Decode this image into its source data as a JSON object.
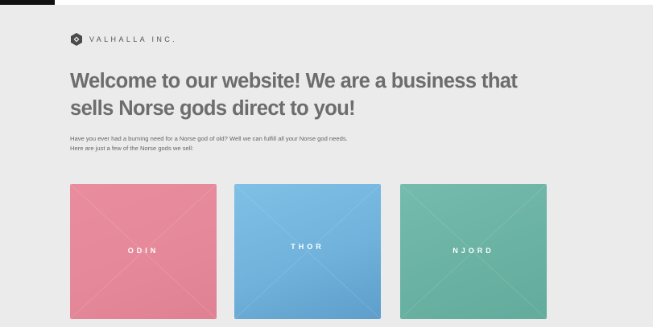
{
  "logo": {
    "text": "VALHALLA INC.",
    "icon": "hexagon-diamond-icon"
  },
  "hero": {
    "title": "Welcome to our website! We are a business that sells Norse gods direct to you!",
    "body_line1": "Have you ever had a burning need for a Norse god of old? Well we can fulfill all your Norse god needs.",
    "body_line2": "Here are just a few of the Norse gods we sell:"
  },
  "cards": [
    {
      "name": "ODIN",
      "color": "#e5899a"
    },
    {
      "name": "THOR",
      "color": "#70b2db"
    },
    {
      "name": "NJORD",
      "color": "#6ab2a3"
    }
  ],
  "colors": {
    "page_background": "#ebebeb",
    "title_text": "#6d6d6d",
    "body_text": "#666666"
  }
}
